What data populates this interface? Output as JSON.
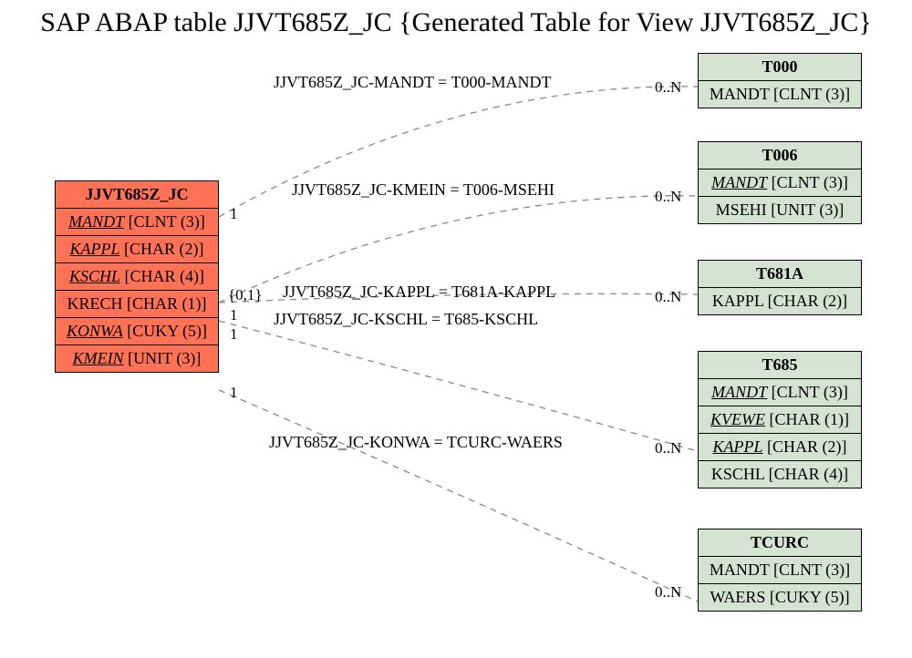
{
  "title": "SAP ABAP table JJVT685Z_JC {Generated Table for View JJVT685Z_JC}",
  "main_entity": {
    "name": "JJVT685Z_JC",
    "fields": [
      {
        "name": "MANDT",
        "type": "[CLNT (3)]",
        "fk": true
      },
      {
        "name": "KAPPL",
        "type": "[CHAR (2)]",
        "fk": true
      },
      {
        "name": "KSCHL",
        "type": "[CHAR (4)]",
        "fk": true
      },
      {
        "name": "KRECH",
        "type": "[CHAR (1)]",
        "fk": false
      },
      {
        "name": "KONWA",
        "type": "[CUKY (5)]",
        "fk": true
      },
      {
        "name": "KMEIN",
        "type": "[UNIT (3)]",
        "fk": true
      }
    ]
  },
  "related": [
    {
      "name": "T000",
      "fields": [
        {
          "name": "MANDT",
          "type": "[CLNT (3)]",
          "fk": false
        }
      ]
    },
    {
      "name": "T006",
      "fields": [
        {
          "name": "MANDT",
          "type": "[CLNT (3)]",
          "fk": true
        },
        {
          "name": "MSEHI",
          "type": "[UNIT (3)]",
          "fk": false
        }
      ]
    },
    {
      "name": "T681A",
      "fields": [
        {
          "name": "KAPPL",
          "type": "[CHAR (2)]",
          "fk": false
        }
      ]
    },
    {
      "name": "T685",
      "fields": [
        {
          "name": "MANDT",
          "type": "[CLNT (3)]",
          "fk": true
        },
        {
          "name": "KVEWE",
          "type": "[CHAR (1)]",
          "fk": true
        },
        {
          "name": "KAPPL",
          "type": "[CHAR (2)]",
          "fk": true
        },
        {
          "name": "KSCHL",
          "type": "[CHAR (4)]",
          "fk": false
        }
      ]
    },
    {
      "name": "TCURC",
      "fields": [
        {
          "name": "MANDT",
          "type": "[CLNT (3)]",
          "fk": false
        },
        {
          "name": "WAERS",
          "type": "[CUKY (5)]",
          "fk": false
        }
      ]
    }
  ],
  "relations": [
    {
      "label": "JJVT685Z_JC-MANDT = T000-MANDT",
      "left_card": "1",
      "right_card": "0..N"
    },
    {
      "label": "JJVT685Z_JC-KMEIN = T006-MSEHI",
      "left_card": "",
      "right_card": "0..N"
    },
    {
      "label": "JJVT685Z_JC-KAPPL = T681A-KAPPL",
      "left_card": "{0,1}",
      "right_card": "0..N"
    },
    {
      "label": "JJVT685Z_JC-KSCHL = T685-KSCHL",
      "left_card": "1",
      "right_card": ""
    },
    {
      "label": "JJVT685Z_JC-KONWA = TCURC-WAERS",
      "left_card": "1",
      "right_card": "0..N"
    }
  ],
  "extra_cards": {
    "c1": "1",
    "last_right": "0..N"
  }
}
